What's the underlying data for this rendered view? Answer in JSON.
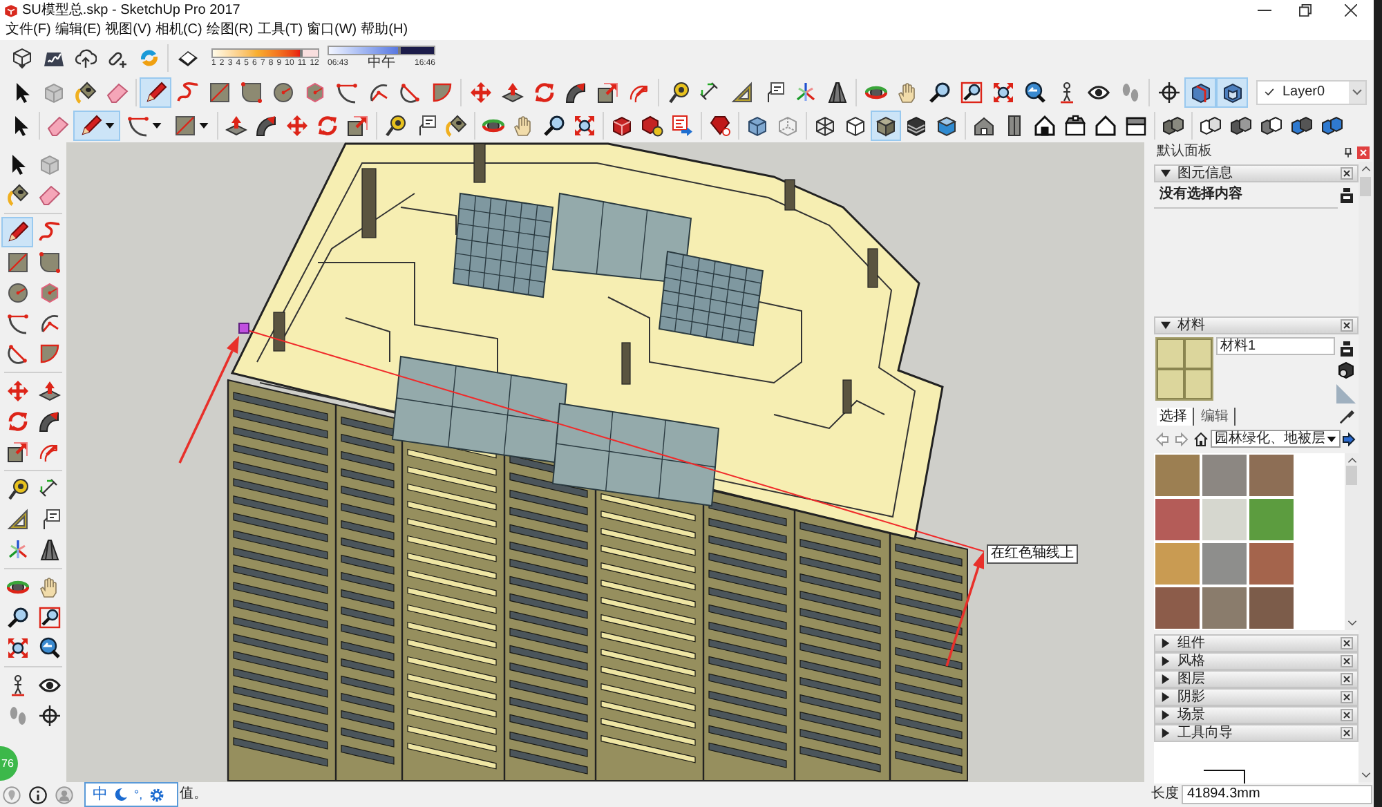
{
  "window": {
    "title": "SU模型总.skp - SketchUp Pro 2017"
  },
  "menu": [
    "文件(F)",
    "编辑(E)",
    "视图(V)",
    "相机(C)",
    "绘图(R)",
    "工具(T)",
    "窗口(W)",
    "帮助(H)"
  ],
  "toolbar_1": {
    "buttons": [
      {
        "selected": false
      },
      {
        "selected": false
      },
      {
        "selected": false
      },
      {
        "selected": false
      },
      {
        "selected": false
      },
      {
        "selected": false
      }
    ],
    "month_slider": {
      "labels": [
        "1",
        "2",
        "3",
        "4",
        "5",
        "6",
        "7",
        "8",
        "9",
        "10",
        "11",
        "12"
      ],
      "level": 0.85
    },
    "time_slider": {
      "labels": [
        "06:43",
        "中午",
        "16:46"
      ],
      "level": 0.68
    }
  },
  "toolbar_2": {
    "buttons": [
      {
        "selected": false
      },
      {
        "selected": false
      },
      {
        "selected": false
      },
      {
        "selected": false
      },
      {
        "selected": true
      },
      {
        "selected": false
      },
      {
        "selected": false
      },
      {
        "selected": false
      },
      {
        "selected": false
      },
      {
        "selected": false
      },
      {
        "selected": false
      },
      {
        "selected": false
      },
      {
        "selected": false
      },
      {
        "selected": false
      },
      {
        "selected": false
      },
      {
        "selected": false
      },
      {
        "selected": false
      },
      {
        "selected": false
      },
      {
        "selected": false
      },
      {
        "selected": false
      },
      {
        "selected": false
      },
      {
        "selected": false
      },
      {
        "selected": false
      },
      {
        "selected": false
      },
      {
        "selected": false
      },
      {
        "selected": false
      },
      {
        "selected": false
      },
      {
        "selected": false
      },
      {
        "selected": false
      },
      {
        "selected": false
      },
      {
        "selected": false
      },
      {
        "selected": false
      },
      {
        "selected": false
      },
      {
        "selected": false
      },
      {
        "selected": false
      },
      {
        "selected": false
      },
      {
        "selected": true
      },
      {
        "selected": true
      }
    ],
    "layer": {
      "value": "Layer0"
    }
  },
  "toolbar_3": {
    "buttons": [
      {
        "selected": false
      },
      {
        "selected": false
      },
      {
        "selected": true
      },
      {
        "selected": false
      },
      {
        "selected": false
      },
      {
        "selected": false
      },
      {
        "selected": false
      },
      {
        "selected": false
      },
      {
        "selected": false
      },
      {
        "selected": false
      },
      {
        "selected": false
      },
      {
        "selected": false
      },
      {
        "selected": false
      },
      {
        "selected": false
      },
      {
        "selected": false
      },
      {
        "selected": false
      },
      {
        "selected": false
      },
      {
        "selected": false
      },
      {
        "selected": false
      },
      {
        "selected": false
      },
      {
        "selected": false
      },
      {
        "selected": false
      },
      {
        "selected": false
      },
      {
        "selected": false
      },
      {
        "selected": false
      },
      {
        "selected": true
      },
      {
        "selected": false
      },
      {
        "selected": false
      },
      {
        "selected": false
      },
      {
        "selected": false
      },
      {
        "selected": false
      },
      {
        "selected": false
      },
      {
        "selected": false
      },
      {
        "selected": false
      },
      {
        "selected": false
      },
      {
        "selected": false
      },
      {
        "selected": false
      },
      {
        "selected": false
      },
      {
        "selected": false
      },
      {
        "selected": false
      }
    ]
  },
  "left_toolbar": {
    "buttons": [
      {
        "selected": false
      },
      {
        "selected": false
      },
      {
        "selected": false
      },
      {
        "selected": false
      },
      {
        "selected": true
      },
      {
        "selected": false
      },
      {
        "selected": false
      },
      {
        "selected": false
      },
      {
        "selected": false
      },
      {
        "selected": false
      },
      {
        "selected": false
      },
      {
        "selected": false
      },
      {
        "selected": false
      },
      {
        "selected": false
      },
      {
        "selected": false
      },
      {
        "selected": false
      },
      {
        "selected": false
      },
      {
        "selected": false
      },
      {
        "selected": false
      },
      {
        "selected": false
      },
      {
        "selected": false
      },
      {
        "selected": false
      },
      {
        "selected": false
      },
      {
        "selected": false
      },
      {
        "selected": false
      },
      {
        "selected": false
      },
      {
        "selected": false
      },
      {
        "selected": false
      },
      {
        "selected": false
      },
      {
        "selected": false
      },
      {
        "selected": false
      },
      {
        "selected": false
      },
      {
        "selected": false
      },
      {
        "selected": false
      },
      {
        "selected": false
      },
      {
        "selected": false
      }
    ]
  },
  "viewport": {
    "tooltip": "在红色轴线上"
  },
  "tray": {
    "title": "默认面板",
    "entity_info": {
      "title": "图元信息",
      "expanded": true,
      "status": "没有选择内容"
    },
    "materials": {
      "title": "材料",
      "expanded": true,
      "name": "材料1",
      "tabs": [
        {
          "label": "选择",
          "selected": true
        },
        {
          "label": "编辑",
          "selected": false
        }
      ],
      "library": "园林绿化、地被层",
      "swatches": [
        {
          "color": "#9c7f52"
        },
        {
          "color": "#8c8782"
        },
        {
          "color": "#8d6e55"
        },
        {
          "color": "#b45c58"
        },
        {
          "color": "#d6d7cf"
        },
        {
          "color": "#5c9c3f"
        },
        {
          "color": "#c99b52"
        },
        {
          "color": "#8e8e8c"
        },
        {
          "color": "#a4644c"
        },
        {
          "color": "#8c5c4a"
        },
        {
          "color": "#8a7c6c"
        },
        {
          "color": "#7c5c4a"
        }
      ]
    },
    "panels": [
      {
        "title": "组件",
        "expanded": false
      },
      {
        "title": "风格",
        "expanded": false
      },
      {
        "title": "图层",
        "expanded": false
      },
      {
        "title": "阴影",
        "expanded": false
      },
      {
        "title": "场景",
        "expanded": false
      },
      {
        "title": "工具向导",
        "expanded": false
      }
    ]
  },
  "status_bar": {
    "ime": {
      "mode": "中",
      "punctuation": "°,"
    },
    "message": "值。",
    "measurement": {
      "label": "长度",
      "value": "41894.3mm"
    }
  },
  "floating_badge": {
    "label": "76"
  }
}
